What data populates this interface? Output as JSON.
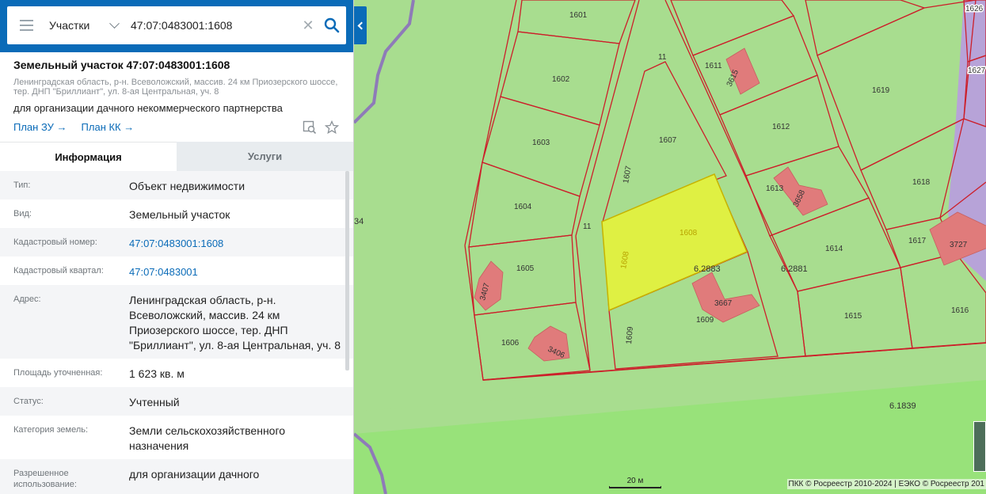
{
  "search": {
    "type_label": "Участки",
    "query": "47:07:0483001:1608"
  },
  "object": {
    "title": "Земельный участок 47:07:0483001:1608",
    "address_line1": "Ленинградская область, р-н. Всеволожский, массив. 24 км Приозерского шоссе,",
    "address_line2": "тер. ДНП \"Бриллиант\", ул. 8-ая Центральная, уч. 8",
    "purpose": "для организации дачного некоммерческого партнерства",
    "link_plan_zu": "План ЗУ →",
    "link_plan_kk": "План КК →"
  },
  "tabs": {
    "info": "Информация",
    "services": "Услуги"
  },
  "info_rows": [
    {
      "label": "Тип:",
      "value": "Объект недвижимости"
    },
    {
      "label": "Вид:",
      "value": "Земельный участок"
    },
    {
      "label": "Кадастровый номер:",
      "value": "47:07:0483001:1608"
    },
    {
      "label": "Кадастровый квартал:",
      "value": "47:07:0483001"
    },
    {
      "label": "Адрес:",
      "value": "Ленинградская область, р-н. Всеволожский, массив. 24 км Приозерского шоссе, тер. ДНП \"Бриллиант\", ул. 8-ая Центральная, уч. 8"
    },
    {
      "label": "Площадь уточненная:",
      "value": "1 623 кв. м"
    },
    {
      "label": "Статус:",
      "value": "Учтенный"
    },
    {
      "label": "Категория земель:",
      "value": "Земли сельскохозяйственного назначения"
    },
    {
      "label": "Разрешенное использование:",
      "value": "для организации дачного"
    }
  ],
  "map": {
    "parcel_labels": [
      "1601",
      "1602",
      "1603",
      "1604",
      "1605",
      "1606",
      "1607",
      "1607",
      "1608",
      "1608",
      "1609",
      "1609",
      "1611",
      "1612",
      "1613",
      "1614",
      "1615",
      "1616",
      "1617",
      "1618",
      "1619",
      "1626",
      "1627",
      "11",
      "11"
    ],
    "building_labels": [
      "3615",
      "3658",
      "3667",
      "3727",
      "3407",
      "3406"
    ],
    "quarter_labels": [
      "6.2883",
      "6.2881",
      "6.1839",
      "34"
    ],
    "scale": "20 м",
    "copyright": "ПКК © Росреестр 2010-2024 | ЕЭКО © Росреестр 201",
    "colors": {
      "background_green": "#a8dd8f",
      "parcel_fill": "#a8dd8f",
      "selected_fill": "#dff043",
      "boundary": "#cc1f2a",
      "building": "#e07b7b",
      "purple_zone": "#b7a3d8",
      "road_line": "#8e7bb8"
    }
  }
}
